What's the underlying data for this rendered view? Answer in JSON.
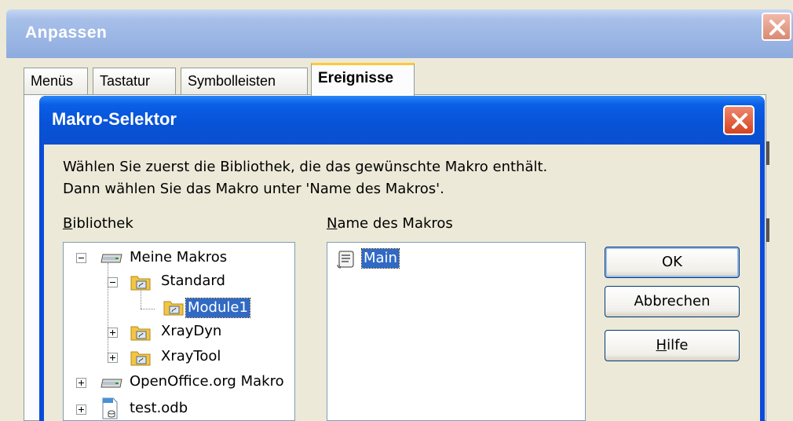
{
  "outer_dialog": {
    "title": "Anpassen",
    "tabs": [
      {
        "label": "Menüs"
      },
      {
        "label": "Tastatur"
      },
      {
        "label": "Symbolleisten"
      },
      {
        "label": "Ereignisse",
        "active": true
      }
    ]
  },
  "macro_selector": {
    "title": "Makro-Selektor",
    "intro_line1": "Wählen Sie zuerst die Bibliothek, die das gewünschte Makro enthält.",
    "intro_line2": "Dann wählen Sie das Makro unter 'Name des Makros'.",
    "library_label_first": "B",
    "library_label_rest": "ibliothek",
    "macro_name_label_first": "N",
    "macro_name_label_rest": "ame des Makros",
    "library_tree": [
      {
        "label": "Meine Makros",
        "expanded": true,
        "icon": "library-container-icon"
      },
      {
        "label": "Standard",
        "expanded": true,
        "icon": "basic-library-folder-icon"
      },
      {
        "label": "Module1",
        "selected": true,
        "icon": "basic-module-icon"
      },
      {
        "label": "XrayDyn",
        "expanded": false,
        "icon": "basic-library-folder-icon"
      },
      {
        "label": "XrayTool",
        "expanded": false,
        "icon": "basic-library-folder-icon"
      },
      {
        "label": "OpenOffice.org Makro",
        "expanded": false,
        "icon": "library-container-icon"
      },
      {
        "label": "test.odb",
        "expanded": false,
        "icon": "database-document-icon"
      }
    ],
    "macros": [
      {
        "label": "Main",
        "selected": true,
        "icon": "macro-scroll-icon"
      }
    ],
    "buttons": {
      "ok": "OK",
      "cancel": "Abbrechen",
      "help_first": "H",
      "help_rest": "ilfe"
    }
  },
  "colors": {
    "inner_title_blue": "#0753d8",
    "selection_blue": "#316ac5",
    "dialog_face": "#ece9d8",
    "close_red": "#d3431f"
  }
}
